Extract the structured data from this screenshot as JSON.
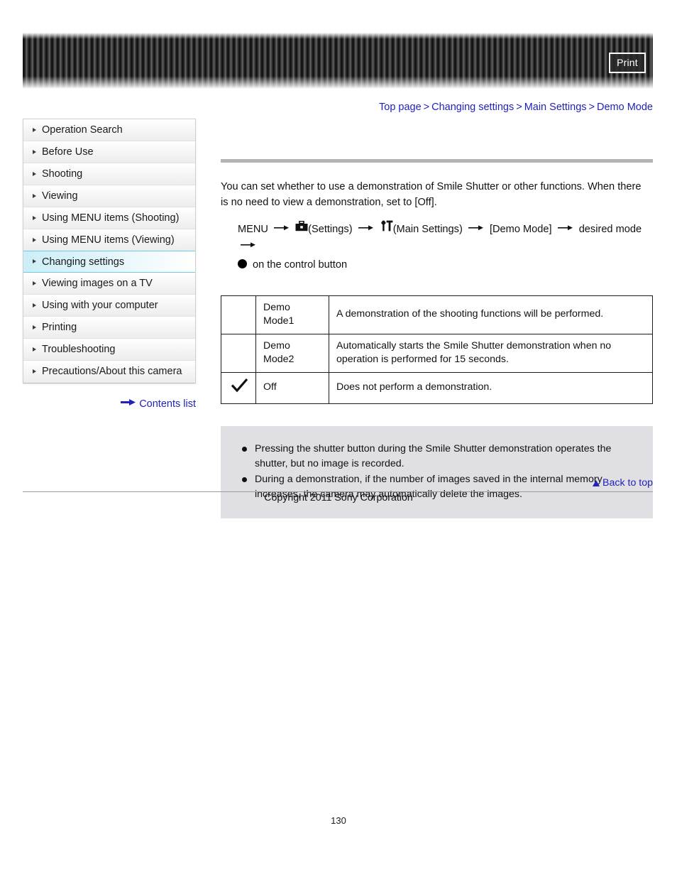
{
  "header": {
    "print_label": "Print"
  },
  "breadcrumb": {
    "items": [
      {
        "label": "Top page"
      },
      {
        "label": "Changing settings"
      },
      {
        "label": "Main Settings"
      },
      {
        "label": "Demo Mode"
      }
    ],
    "separator": ">"
  },
  "sidebar": {
    "items": [
      {
        "label": "Operation Search",
        "selected": false
      },
      {
        "label": "Before Use",
        "selected": false
      },
      {
        "label": "Shooting",
        "selected": false
      },
      {
        "label": "Viewing",
        "selected": false
      },
      {
        "label": "Using MENU items (Shooting)",
        "selected": false
      },
      {
        "label": "Using MENU items (Viewing)",
        "selected": false
      },
      {
        "label": "Changing settings",
        "selected": true
      },
      {
        "label": "Viewing images on a TV",
        "selected": false
      },
      {
        "label": "Using with your computer",
        "selected": false
      },
      {
        "label": "Printing",
        "selected": false
      },
      {
        "label": "Troubleshooting",
        "selected": false
      },
      {
        "label": "Precautions/About this camera",
        "selected": false
      }
    ],
    "contents_link": "Contents list"
  },
  "main": {
    "intro": "You can set whether to use a demonstration of Smile Shutter or other functions. When there is no need to view a demonstration, set to [Off].",
    "menu_path": {
      "start": "MENU",
      "settings_label": "(Settings)",
      "main_settings_label": "(Main Settings)",
      "demo_mode_label": "[Demo Mode]",
      "desired_mode_label": "desired mode",
      "control_button_label": "on the control button"
    },
    "table": {
      "rows": [
        {
          "checked": false,
          "name": "Demo Mode1",
          "description": "A demonstration of the shooting functions will be performed."
        },
        {
          "checked": false,
          "name": "Demo Mode2",
          "description": "Automatically starts the Smile Shutter demonstration when no operation is performed for 15 seconds."
        },
        {
          "checked": true,
          "name": "Off",
          "description": "Does not perform a demonstration."
        }
      ]
    },
    "notes": [
      "Pressing the shutter button during the Smile Shutter demonstration operates the shutter, but no image is recorded.",
      "During a demonstration, if the number of images saved in the internal memory increases, the camera may automatically delete the images."
    ]
  },
  "footer": {
    "back_to_top": "Back to top",
    "copyright": "Copyright 2011 Sony Corporation",
    "page_number": "130"
  },
  "colors": {
    "link": "#2222bb",
    "selected_sidebar_border": "#6fc9e0",
    "notes_background": "#dfdfe4",
    "rule_bar": "#b3b3b3"
  }
}
